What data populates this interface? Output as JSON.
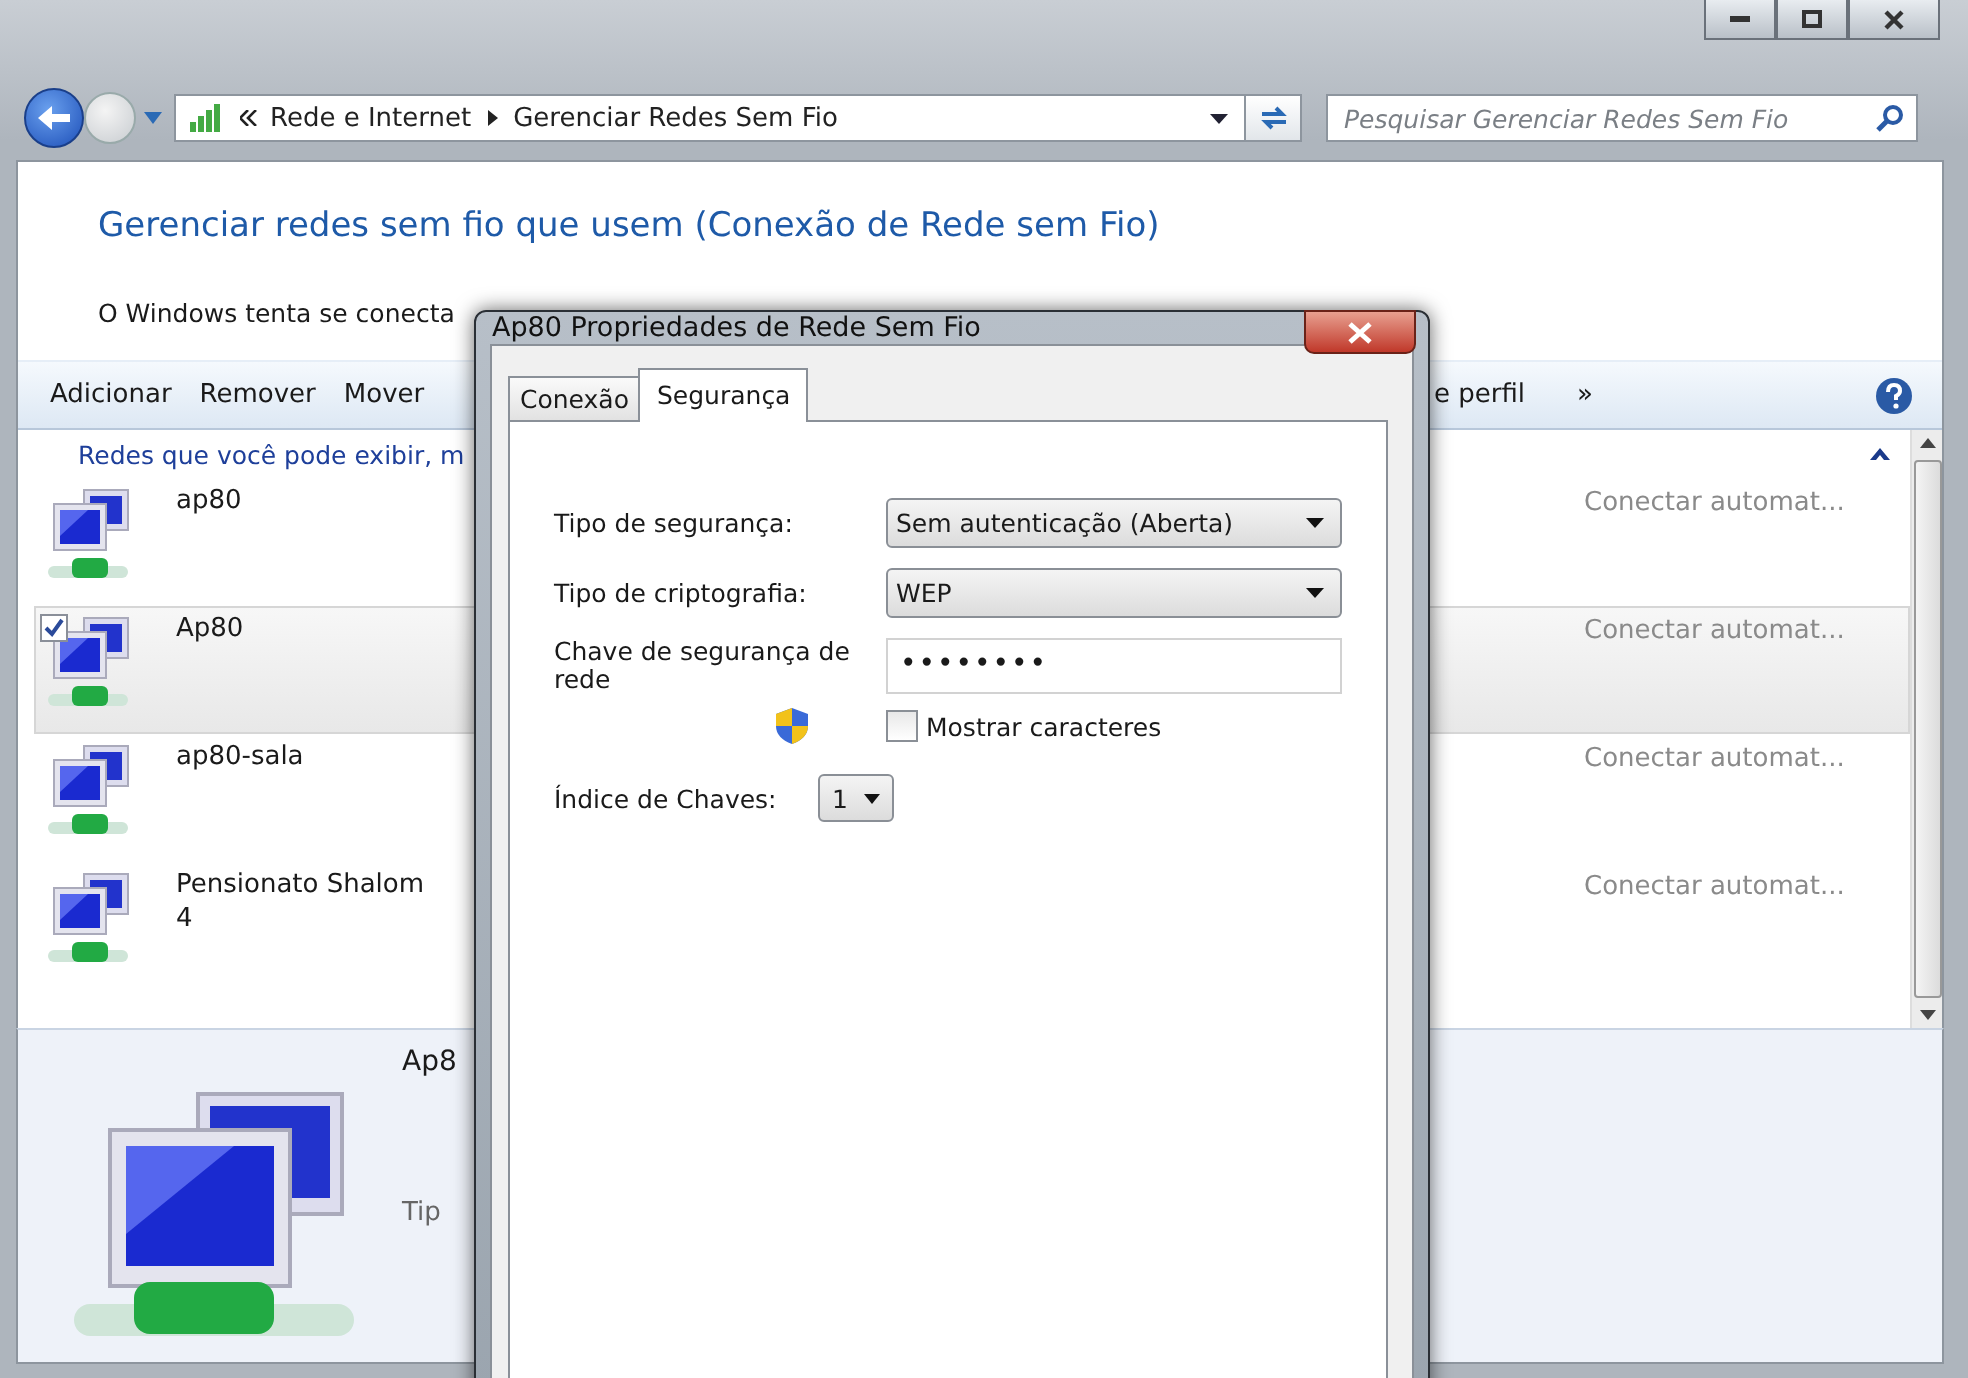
{
  "window": {
    "nav_path": [
      "Rede e Internet",
      "Gerenciar Redes Sem Fio"
    ],
    "search": {
      "placeholder": "Pesquisar Gerenciar Redes Sem Fio"
    }
  },
  "heading": "Gerenciar redes sem fio que usem (Conexão de Rede sem Fio)",
  "intro": "O Windows tenta se conecta",
  "toolbar": {
    "left": [
      "Adicionar",
      "Remover",
      "Mover"
    ],
    "right": [
      "e perfil",
      "»"
    ]
  },
  "group_header": "Redes que você pode exibir, m",
  "networks": [
    {
      "name": "ap80",
      "mode": "Conectar automat...",
      "selected": false,
      "checked": false
    },
    {
      "name": "Ap80",
      "mode": "Conectar automat...",
      "selected": true,
      "checked": true
    },
    {
      "name": "ap80-sala",
      "mode": "Conectar automat...",
      "selected": false,
      "checked": false
    },
    {
      "name": "Pensionato Shalom 4",
      "mode": "Conectar automat...",
      "selected": false,
      "checked": false
    }
  ],
  "details": {
    "name": "Ap8",
    "type": "Tip"
  },
  "dialog": {
    "title": "Ap80 Propriedades de Rede Sem Fio",
    "tabs": [
      {
        "label": "Conexão",
        "selected": false
      },
      {
        "label": "Segurança",
        "selected": true
      }
    ],
    "fields": [
      {
        "kind": "select",
        "label": "Tipo de segurança:",
        "value": "Sem autenticação (Aberta)"
      },
      {
        "kind": "select",
        "label": "Tipo de criptografia:",
        "value": "WEP"
      },
      {
        "kind": "password",
        "label": "Chave de segurança de rede",
        "value": "••••••••"
      },
      {
        "kind": "checkbox",
        "label": "Mostrar caracteres",
        "checked": false
      },
      {
        "kind": "small-select",
        "label": "Índice de Chaves:",
        "value": "1"
      }
    ]
  }
}
